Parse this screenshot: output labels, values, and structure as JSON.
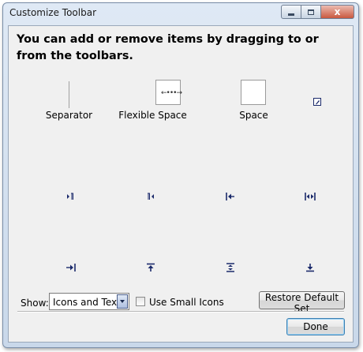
{
  "window": {
    "title": "Customize Toolbar",
    "controls": {
      "minimize": "minimize-icon",
      "maximize": "maximize-icon",
      "close_glyph": "x"
    }
  },
  "instructions": "You can add or remove items by dragging to or from the toolbars.",
  "palette": {
    "separator_label": "Separator",
    "flexible_space_label": "Flexible Space",
    "flexible_space_glyph": "←•••→",
    "space_label": "Space",
    "icons": [
      "pencil-icon",
      "ltr-mark-icon",
      "rtl-mark-icon",
      "indent-left-icon",
      "indent-both-icon",
      "indent-right-icon",
      "align-top-icon",
      "align-middle-icon",
      "align-bottom-icon"
    ]
  },
  "bottom": {
    "show_label": "Show:",
    "show_value": "Icons and Text",
    "small_icons_label": "Use Small Icons",
    "restore_label": "Restore Default Set"
  },
  "footer": {
    "done_label": "Done"
  },
  "colors": {
    "icon": "#1b2a6b",
    "client_bg": "#f0f0f0",
    "close_button": "#c9583f"
  }
}
